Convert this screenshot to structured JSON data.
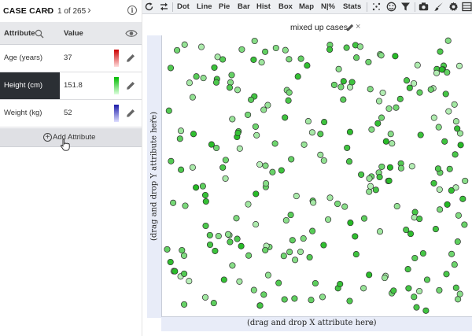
{
  "case_card": {
    "title": "CASE CARD",
    "prev": "‹",
    "next": "›",
    "count": "1 of 265",
    "info_icon": "info-icon",
    "headers": {
      "attribute": "Attribute",
      "value": "Value"
    },
    "rows": [
      {
        "name": "Age (years)",
        "value": "37",
        "swatch": [
          "#cc0000",
          "#ffdddd"
        ]
      },
      {
        "name": "Height (cm)",
        "value": "151.8",
        "swatch": [
          "#00bb00",
          "#ddffdd"
        ],
        "selected": true
      },
      {
        "name": "Weight (kg)",
        "value": "52",
        "swatch": [
          "#1a1aa8",
          "#ddddff"
        ]
      }
    ],
    "add_label": "Add Attribute"
  },
  "toolbar": {
    "items": [
      "Dot",
      "Line",
      "Pie",
      "Bar",
      "Hist",
      "Box",
      "Map",
      "N|%",
      "Stats"
    ]
  },
  "graph": {
    "title": "mixed up cases",
    "x_placeholder": "(drag and drop X attribute here)",
    "y_placeholder": "(drag and drop Y attribute here)",
    "close_glyph": "×"
  },
  "colors": {
    "point_fill_dark": "#22b922",
    "point_fill_light": "#b8efb8",
    "point_stroke": "#2d2d2d",
    "selected_row": "#2b2f34",
    "axis_band": "#e8ecf8"
  }
}
